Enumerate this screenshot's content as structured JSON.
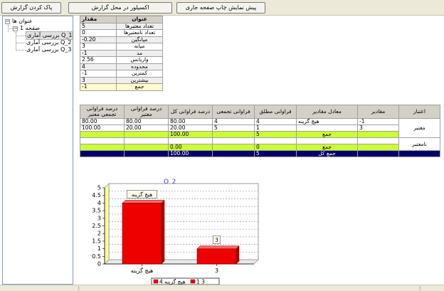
{
  "toolbar": {
    "clear_label": "پاک کردن گزارش",
    "excel_label": "اکسپلور در محل گزارش",
    "print_label": "پیش نمایش چاپ صفحه جاری"
  },
  "tree": {
    "root": "عنوان ها",
    "page": "صفحه 1",
    "items": [
      "بررسی آماری Q_1",
      "بررسی آماری Q_2",
      "بررسی آماری Q_3"
    ],
    "selected_index": 0
  },
  "stats": {
    "header": {
      "value": "مقدار",
      "label": "عنوان"
    },
    "rows": [
      {
        "value": "5",
        "label": "تعداد معتبرها"
      },
      {
        "value": "0",
        "label": "تعداد نامعتبرها"
      },
      {
        "value": "-0.20",
        "label": "میانگین"
      },
      {
        "value": "3",
        "label": "میانه"
      },
      {
        "value": "-1",
        "label": "مد"
      },
      {
        "value": "2.56",
        "label": "واریانس"
      },
      {
        "value": "4",
        "label": "محدوده"
      },
      {
        "value": "-1",
        "label": "کمترین"
      },
      {
        "value": "3",
        "label": "بیشترین"
      },
      {
        "value": "-1",
        "label": "جمع"
      }
    ]
  },
  "freq": {
    "headers": [
      "درصد فراوانی تجمعی معتبر",
      "درصد فراوانی معتبر",
      "درصد فراوانی کل",
      "فراوانی تجمعی",
      "فراوانی مطلق",
      "معادل مقادیر",
      "مقادیر",
      "اعتبار"
    ],
    "valid_label": "معتبر",
    "invalid_label": "نامعتبر",
    "sum_label": "جمع",
    "total_label": "جمع کل",
    "valid_rows": [
      {
        "cum_valid_pct": "80.00",
        "valid_pct": "80.00",
        "total_pct": "80.00",
        "cum_freq": "4",
        "freq": "4",
        "equiv": "هیچ گزینه",
        "value": "-1"
      },
      {
        "cum_valid_pct": "100.00",
        "valid_pct": "20.00",
        "total_pct": "20.00",
        "cum_freq": "5",
        "freq": "1",
        "equiv": "",
        "value": "3"
      }
    ],
    "valid_sum": {
      "total_pct": "100.00",
      "freq": "5"
    },
    "invalid_sum": {
      "total_pct": "0.00",
      "freq": "0"
    },
    "grand_total": {
      "total_pct": "100.00",
      "freq": "5"
    }
  },
  "chart_data": {
    "type": "bar",
    "title": "Q_2",
    "categories": [
      "هیچ گزینه",
      "3"
    ],
    "values": [
      4,
      1
    ],
    "data_labels": [
      "هیچ گزینه",
      "3"
    ],
    "ylim": [
      0,
      5
    ],
    "yticks": [
      "0",
      "0.5",
      "1",
      "1.5",
      "2",
      "2.5",
      "3",
      "3.5",
      "4",
      "4.5",
      "5"
    ],
    "grid": true,
    "legend": {
      "placement": "bottom",
      "entries": [
        "هیچ گزینه 4",
        "1 3"
      ]
    },
    "bar_color": "#ee0000"
  }
}
